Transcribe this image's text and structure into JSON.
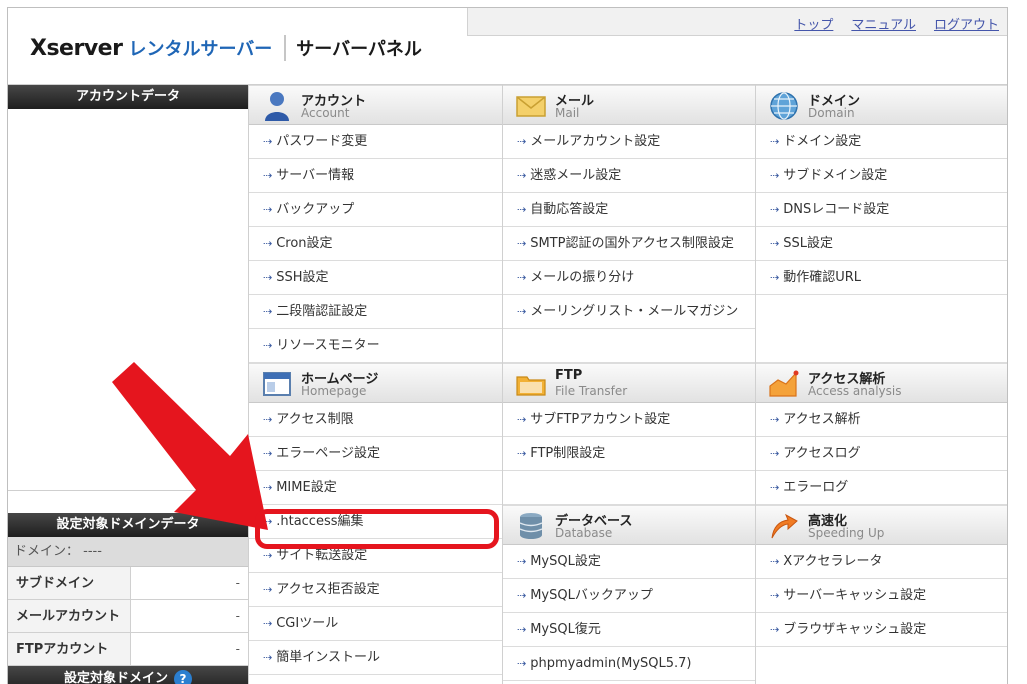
{
  "header": {
    "brand": "Xserver",
    "rental": "レンタルサーバー",
    "panel": "サーバーパネル",
    "nav": [
      "トップ",
      "マニュアル",
      "ログアウト"
    ]
  },
  "sidebar": {
    "account_title": "アカウントデータ",
    "domain_title": "設定対象ドメインデータ",
    "domain_label": "ドメイン： ----",
    "rows": [
      {
        "key": "サブドメイン",
        "value": "-"
      },
      {
        "key": "メールアカウント",
        "value": "-"
      },
      {
        "key": "FTPアカウント",
        "value": "-"
      }
    ],
    "target_title": "設定対象ドメイン",
    "help": "?"
  },
  "sections": {
    "account": {
      "title": "アカウント",
      "sub": "Account",
      "items": [
        "パスワード変更",
        "サーバー情報",
        "バックアップ",
        "Cron設定",
        "SSH設定",
        "二段階認証設定",
        "リソースモニター"
      ]
    },
    "mail": {
      "title": "メール",
      "sub": "Mail",
      "items": [
        "メールアカウント設定",
        "迷惑メール設定",
        "自動応答設定",
        "SMTP認証の国外アクセス制限設定",
        "メールの振り分け",
        "メーリングリスト・メールマガジン"
      ]
    },
    "domain": {
      "title": "ドメイン",
      "sub": "Domain",
      "items": [
        "ドメイン設定",
        "サブドメイン設定",
        "DNSレコード設定",
        "SSL設定",
        "動作確認URL"
      ]
    },
    "homepage": {
      "title": "ホームページ",
      "sub": "Homepage",
      "items": [
        "アクセス制限",
        "エラーページ設定",
        "MIME設定",
        ".htaccess編集",
        "サイト転送設定",
        "アクセス拒否設定",
        "CGIツール",
        "簡単インストール"
      ]
    },
    "ftp": {
      "title": "FTP",
      "sub": "File Transfer",
      "items": [
        "サブFTPアカウント設定",
        "FTP制限設定"
      ]
    },
    "access": {
      "title": "アクセス解析",
      "sub": "Access analysis",
      "items": [
        "アクセス解析",
        "アクセスログ",
        "エラーログ"
      ]
    },
    "database": {
      "title": "データベース",
      "sub": "Database",
      "items": [
        "MySQL設定",
        "MySQLバックアップ",
        "MySQL復元",
        "phpmyadmin(MySQL5.7)"
      ]
    },
    "speed": {
      "title": "高速化",
      "sub": "Speeding Up",
      "items": [
        "Xアクセラレータ",
        "サーバーキャッシュ設定",
        "ブラウザキャッシュ設定"
      ]
    }
  },
  "arrow_glyph": "⇢",
  "colors": {
    "accent_blue": "#1f66b6",
    "highlight_red": "#e5151e",
    "link": "#4455aa"
  }
}
